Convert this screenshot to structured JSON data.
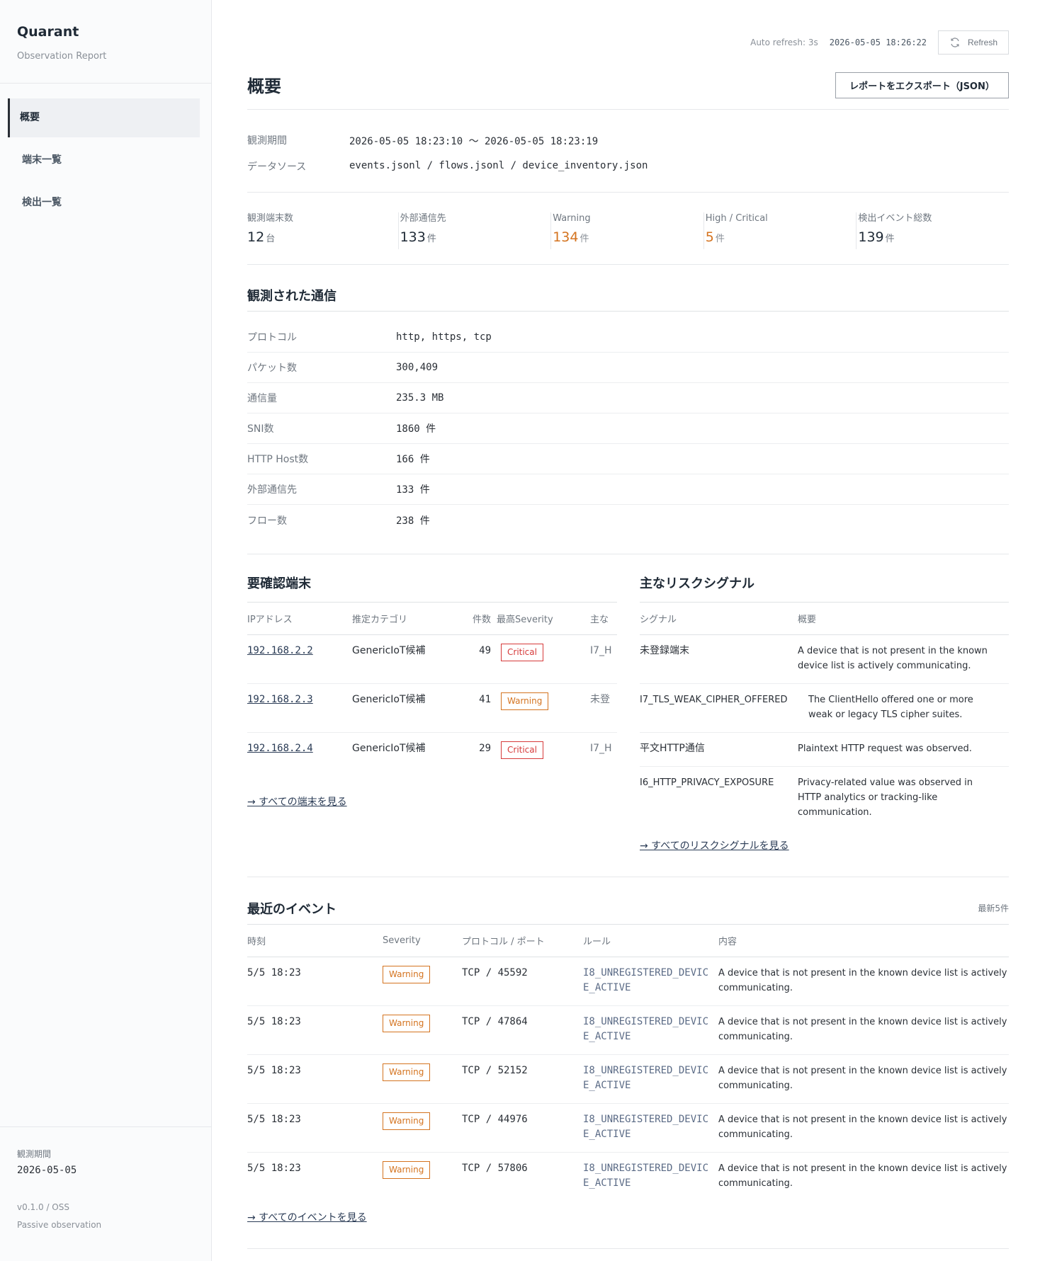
{
  "sidebar": {
    "brand": "Quarant",
    "subtitle": "Observation Report",
    "nav": [
      "概要",
      "端末一覧",
      "検出一覧"
    ],
    "period_label": "観測期間",
    "period_value": "2026-05-05",
    "version": "v0.1.0 / OSS",
    "mode": "Passive observation"
  },
  "topbar": {
    "auto_refresh": "Auto refresh: 3s",
    "timestamp": "2026-05-05 18:26:22",
    "refresh_label": "Refresh"
  },
  "header": {
    "title": "概要",
    "export_label": "レポートをエクスポート（JSON）"
  },
  "meta": {
    "period_label": "観測期間",
    "period_value": "2026-05-05 18:23:10 〜 2026-05-05 18:23:19",
    "source_label": "データソース",
    "source_value": "events.jsonl / flows.jsonl / device_inventory.json"
  },
  "stats": [
    {
      "label": "観測端末数",
      "value": "12",
      "unit": "台",
      "highlight": false
    },
    {
      "label": "外部通信先",
      "value": "133",
      "unit": "件",
      "highlight": false
    },
    {
      "label": "Warning",
      "value": "134",
      "unit": "件",
      "highlight": true
    },
    {
      "label": "High / Critical",
      "value": "5",
      "unit": "件",
      "highlight": true
    },
    {
      "label": "検出イベント総数",
      "value": "139",
      "unit": "件",
      "highlight": false
    }
  ],
  "traffic": {
    "title": "観測された通信",
    "rows": [
      {
        "label": "プロトコル",
        "value": "http, https, tcp"
      },
      {
        "label": "パケット数",
        "value": "300,409"
      },
      {
        "label": "通信量",
        "value": "235.3 MB"
      },
      {
        "label": "SNI数",
        "value": "1860 件"
      },
      {
        "label": "HTTP Host数",
        "value": "166 件"
      },
      {
        "label": "外部通信先",
        "value": "133 件"
      },
      {
        "label": "フロー数",
        "value": "238 件"
      }
    ]
  },
  "devices": {
    "title": "要確認端末",
    "columns": [
      "IPアドレス",
      "推定カテゴリ",
      "件数",
      "最高Severity",
      "主な"
    ],
    "rows": [
      {
        "ip": "192.168.2.2",
        "category": "GenericIoT候補",
        "count": "49",
        "severity": "Critical",
        "sev_class": "critical",
        "main": "I7_H"
      },
      {
        "ip": "192.168.2.3",
        "category": "GenericIoT候補",
        "count": "41",
        "severity": "Warning",
        "sev_class": "warning",
        "main": "未登"
      },
      {
        "ip": "192.168.2.4",
        "category": "GenericIoT候補",
        "count": "29",
        "severity": "Critical",
        "sev_class": "critical",
        "main": "I7_H"
      }
    ],
    "more_link": "→ すべての端末を見る"
  },
  "signals": {
    "title": "主なリスクシグナル",
    "columns": [
      "シグナル",
      "概要"
    ],
    "rows": [
      {
        "signal": "未登録端末",
        "summary": "A device that is not present in the known device list is actively communicating."
      },
      {
        "signal": "I7_TLS_WEAK_CIPHER_OFFERED",
        "summary": "The ClientHello offered one or more weak or legacy TLS cipher suites."
      },
      {
        "signal": "平文HTTP通信",
        "summary": "Plaintext HTTP request was observed."
      },
      {
        "signal": "I6_HTTP_PRIVACY_EXPOSURE",
        "summary": "Privacy-related value was observed in HTTP analytics or tracking-like communication."
      }
    ],
    "more_link": "→ すべてのリスクシグナルを見る"
  },
  "events": {
    "title": "最近のイベント",
    "latest_label": "最新5件",
    "columns": [
      "時刻",
      "Severity",
      "プロトコル / ポート",
      "ルール",
      "内容"
    ],
    "rows": [
      {
        "time": "5/5 18:23",
        "severity": "Warning",
        "proto": "TCP / 45592",
        "rule": "I8_UNREGISTERED_DEVICE_ACTIVE",
        "content": "A device that is not present in the known device list is actively communicating."
      },
      {
        "time": "5/5 18:23",
        "severity": "Warning",
        "proto": "TCP / 47864",
        "rule": "I8_UNREGISTERED_DEVICE_ACTIVE",
        "content": "A device that is not present in the known device list is actively communicating."
      },
      {
        "time": "5/5 18:23",
        "severity": "Warning",
        "proto": "TCP / 52152",
        "rule": "I8_UNREGISTERED_DEVICE_ACTIVE",
        "content": "A device that is not present in the known device list is actively communicating."
      },
      {
        "time": "5/5 18:23",
        "severity": "Warning",
        "proto": "TCP / 44976",
        "rule": "I8_UNREGISTERED_DEVICE_ACTIVE",
        "content": "A device that is not present in the known device list is actively communicating."
      },
      {
        "time": "5/5 18:23",
        "severity": "Warning",
        "proto": "TCP / 57806",
        "rule": "I8_UNREGISTERED_DEVICE_ACTIVE",
        "content": "A device that is not present in the known device list is actively communicating."
      }
    ],
    "more_link": "→ すべてのイベントを見る"
  },
  "colors": {
    "critical": "#d63a3a",
    "warning": "#d4731f",
    "link": "#2a3b55"
  }
}
